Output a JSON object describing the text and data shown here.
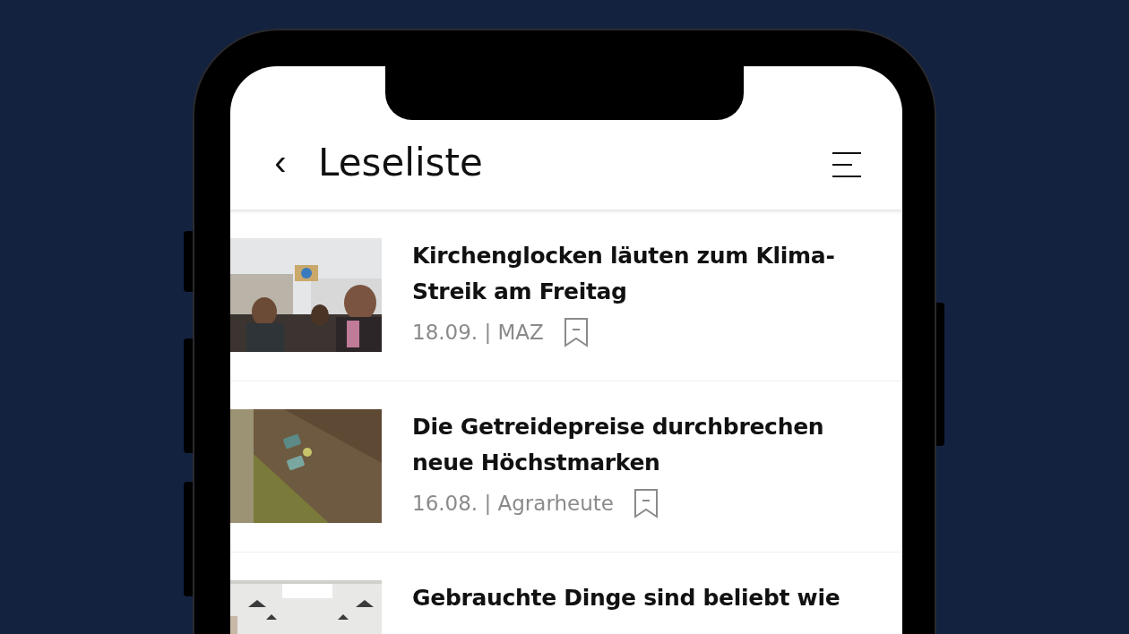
{
  "header": {
    "back": "‹",
    "title": "Leseliste"
  },
  "articles": [
    {
      "kind": "picture",
      "title": "Kirchenglocken läuten zum Klima-Streik am Freitag",
      "meta": "18.09. | MAZ",
      "saved": true
    },
    {
      "kind": "picture",
      "title": "Die Getreidepreise durchbrechen neue Höchstmarken",
      "meta": "16.08. | Agrarheute",
      "saved": true
    },
    {
      "kind": "picture",
      "title": "Gebrauchte Dinge sind beliebt wie"
    }
  ]
}
